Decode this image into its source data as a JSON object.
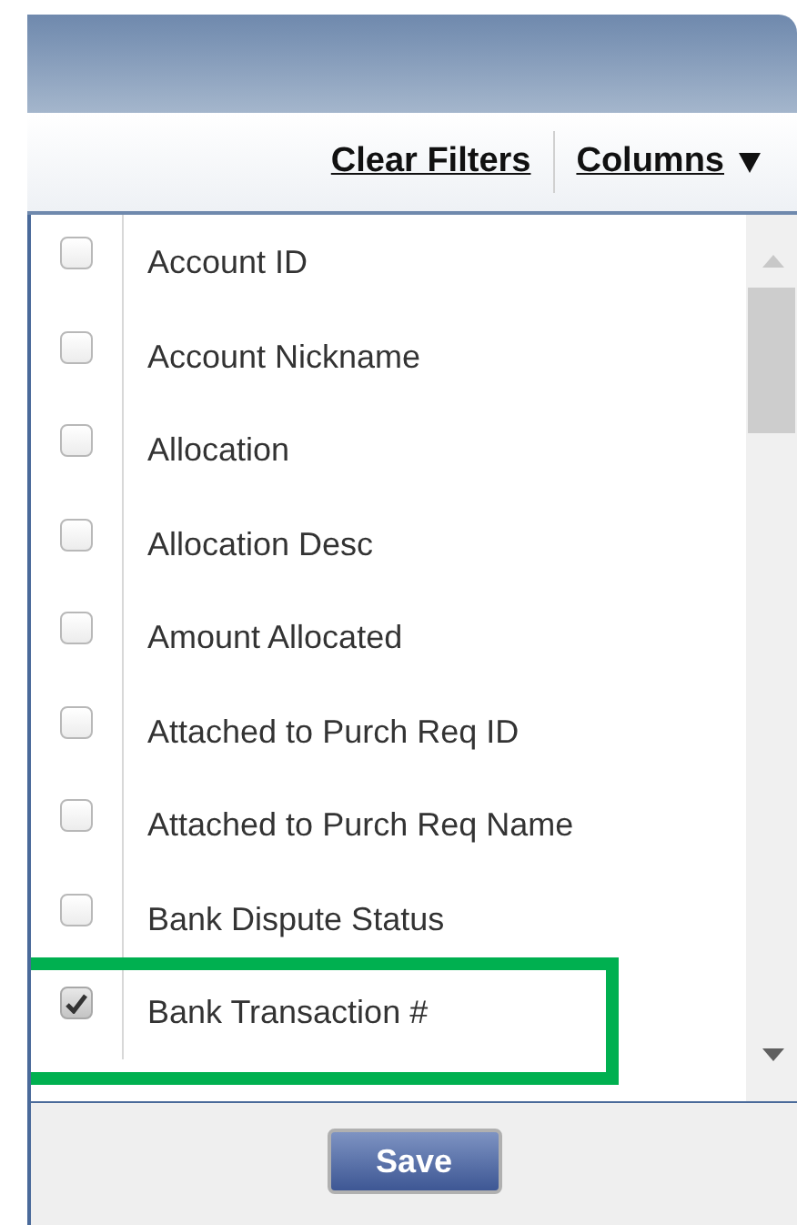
{
  "toolbar": {
    "links": [
      {
        "label": "Clear Filters",
        "kind": "link"
      },
      {
        "label": "Columns",
        "kind": "menu"
      }
    ]
  },
  "columns_list": {
    "items": [
      {
        "label": "Account ID",
        "checked": false,
        "highlighted": false
      },
      {
        "label": "Account Nickname",
        "checked": false,
        "highlighted": false
      },
      {
        "label": "Allocation",
        "checked": false,
        "highlighted": false
      },
      {
        "label": "Allocation Desc",
        "checked": false,
        "highlighted": false
      },
      {
        "label": "Amount Allocated",
        "checked": false,
        "highlighted": false
      },
      {
        "label": "Attached to Purch Req ID",
        "checked": false,
        "highlighted": false
      },
      {
        "label": "Attached to Purch Req Name",
        "checked": false,
        "highlighted": false
      },
      {
        "label": "Bank Dispute Status",
        "checked": false,
        "highlighted": false
      },
      {
        "label": "Bank Transaction #",
        "checked": true,
        "highlighted": true
      }
    ]
  },
  "footer": {
    "button": "Save"
  }
}
